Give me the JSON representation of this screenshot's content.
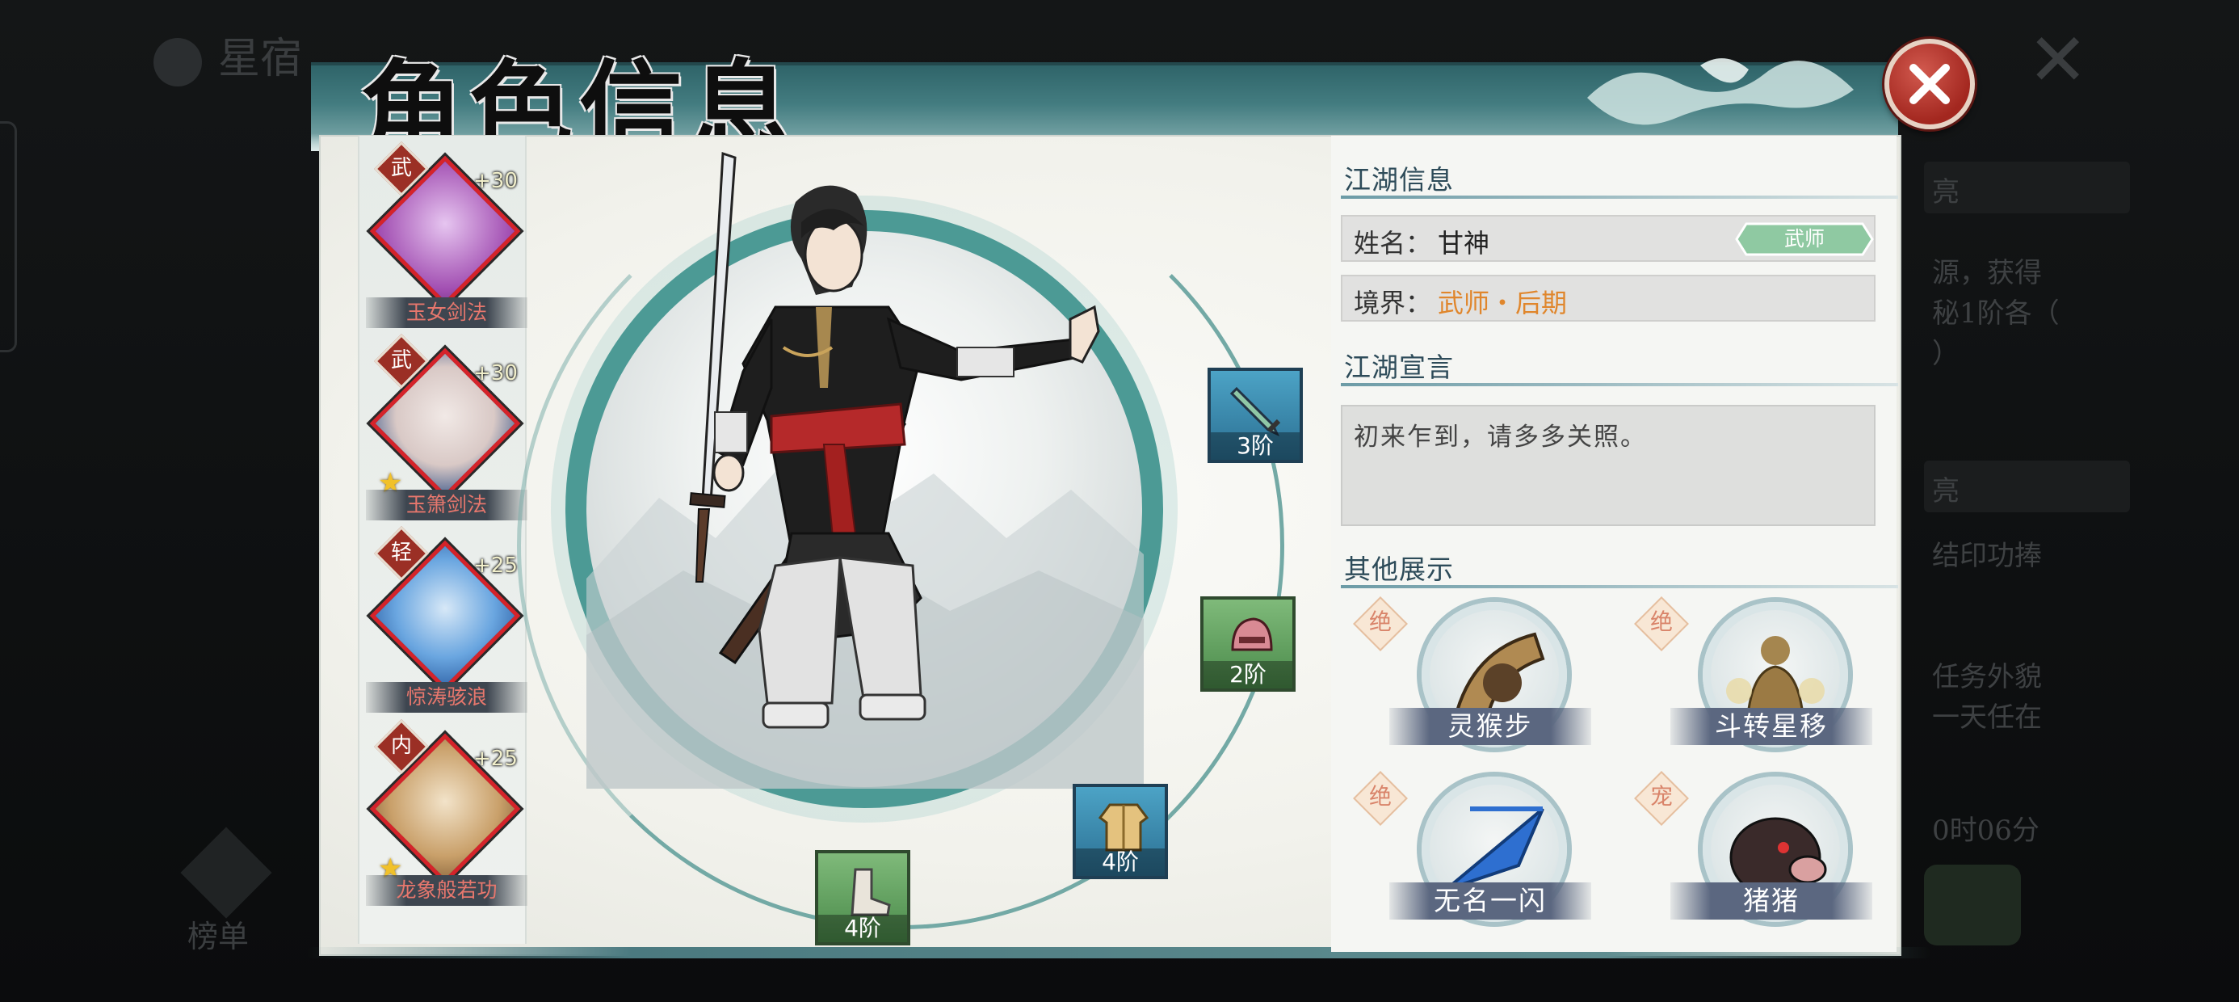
{
  "background": {
    "top_left_text": "星宿",
    "rank_label": "榜单",
    "right_panel_lines": [
      "亮",
      "源，获得",
      "秘1阶各（",
      "）",
      "亮",
      "结印功捧",
      "任务外貌",
      "一天任在",
      "0时06分"
    ]
  },
  "dialog": {
    "title": "角色信息",
    "close_label": "close"
  },
  "skills": [
    {
      "type": "武",
      "bonus": "+30",
      "name": "玉女剑法",
      "starred": false,
      "art_color": "#a24fb2"
    },
    {
      "type": "武",
      "bonus": "+30",
      "name": "玉箫剑法",
      "starred": true,
      "art_color": "#2f4f86"
    },
    {
      "type": "轻",
      "bonus": "+25",
      "name": "惊涛骇浪",
      "starred": false,
      "art_color": "#2d6fc4"
    },
    {
      "type": "内",
      "bonus": "+25",
      "name": "龙象般若功",
      "starred": true,
      "art_color": "#b98c52"
    }
  ],
  "equipment": [
    {
      "slot": "weapon",
      "icon": "sword-icon",
      "tier": "3阶",
      "rarity": "blue"
    },
    {
      "slot": "helmet",
      "icon": "helmet-icon",
      "tier": "2阶",
      "rarity": "green"
    },
    {
      "slot": "armor",
      "icon": "armor-icon",
      "tier": "4阶",
      "rarity": "blue"
    },
    {
      "slot": "boots",
      "icon": "boots-icon",
      "tier": "4阶",
      "rarity": "green"
    }
  ],
  "info": {
    "section_jianghu": "江湖信息",
    "name_label": "姓名：",
    "name_value": "甘神",
    "rank_badge": "武师",
    "realm_label": "境界：",
    "realm_value": "武师・后期",
    "section_motto": "江湖宣言",
    "motto": "初来乍到，请多多关照。",
    "section_other": "其他展示",
    "extras": [
      {
        "tag": "绝",
        "name": "灵猴步",
        "icon": "monkey-icon"
      },
      {
        "tag": "绝",
        "name": "斗转星移",
        "icon": "meditating-monk-icon"
      },
      {
        "tag": "绝",
        "name": "无名一闪",
        "icon": "blade-slash-icon"
      },
      {
        "tag": "宠",
        "name": "猪猪",
        "icon": "boar-icon"
      }
    ]
  },
  "colors": {
    "accent_teal": "#4c9a95",
    "realm_orange": "#e0862c",
    "skill_red": "#d5232a",
    "rank_badge_green": "#8fc9a2"
  }
}
